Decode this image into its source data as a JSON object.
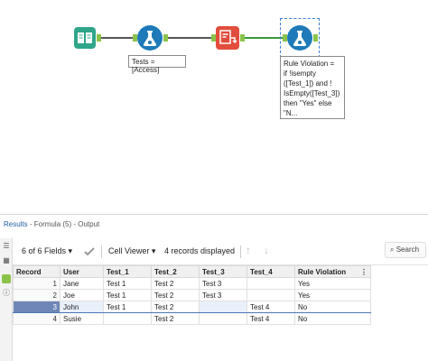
{
  "workflow": {
    "tools": [
      {
        "name": "input-data-tool",
        "icon": "book-icon",
        "color": "#2fa58a"
      },
      {
        "name": "formula-tool",
        "icon": "flask-icon",
        "color": "#1e7ab8"
      },
      {
        "name": "dynamic-select-tool",
        "icon": "dynamic-select-icon",
        "color": "#e24d3c"
      },
      {
        "name": "formula-tool-selected",
        "icon": "flask-icon",
        "color": "#1e7ab8"
      }
    ],
    "annotation_1": "Tests = [Access]",
    "annotation_2": "Rule Violation =\nif !isempty\n([Test_1]) and !\nIsEmpty([Test_3])\nthen \"Yes\" else\n\"N..."
  },
  "results": {
    "title": "Results",
    "subtitle": " - Formula (5) - Output",
    "fields_label": "6 of 6 Fields",
    "cell_viewer_label": "Cell Viewer",
    "records_label": "4 records displayed",
    "search_label": "Search",
    "columns": [
      "Record",
      "User",
      "Test_1",
      "Test_2",
      "Test_3",
      "Test_4",
      "Rule Violation"
    ],
    "rows": [
      [
        "1",
        "Jane",
        "Test 1",
        "Test 2",
        "Test 3",
        "",
        "Yes"
      ],
      [
        "2",
        "Joe",
        "Test 1",
        "Test 2",
        "Test 3",
        "",
        "Yes"
      ],
      [
        "3",
        "John",
        "Test 1",
        "Test 2",
        "",
        "Test 4",
        "No"
      ],
      [
        "4",
        "Susie",
        "",
        "Test 2",
        "",
        "Test 4",
        "No"
      ]
    ],
    "selected_row": 3
  },
  "colors": {
    "accent": "#1f5fa6",
    "anchor": "#8bc34a",
    "selected_row": "#6f87b8"
  }
}
